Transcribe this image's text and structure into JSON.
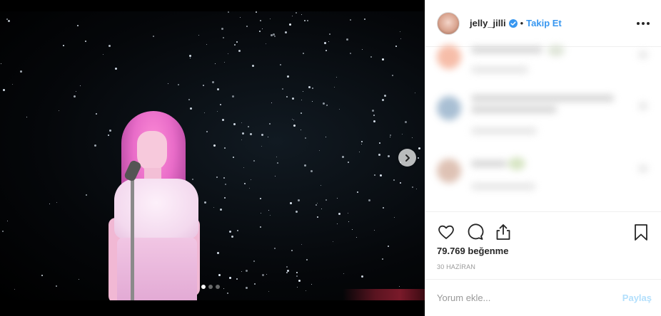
{
  "post": {
    "username": "jelly_jilli",
    "separator": "•",
    "follow_label": "Takip Et",
    "likes_text": "79.769 beğenme",
    "date_text": "30 HAZİRAN"
  },
  "media": {
    "slide_count": 3,
    "active_slide": 1
  },
  "comment_box": {
    "placeholder": "Yorum ekle...",
    "submit_label": "Paylaş"
  },
  "icons": {
    "verified": "verified-badge-icon",
    "more": "more-options-icon",
    "like": "heart-icon",
    "comment": "comment-icon",
    "share": "share-icon",
    "save": "bookmark-icon",
    "next": "chevron-right-icon"
  },
  "colors": {
    "accent": "#3897f0",
    "share_disabled": "#b2dffc",
    "text": "#262626",
    "muted": "#999999"
  }
}
